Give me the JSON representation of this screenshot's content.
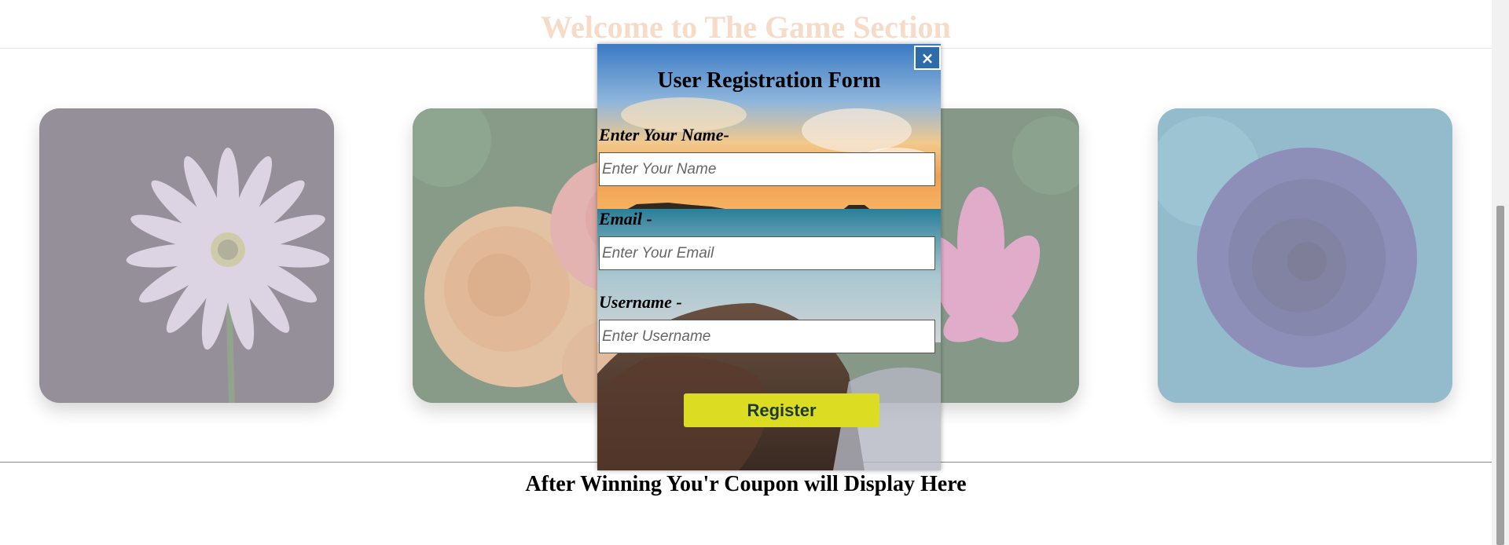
{
  "page": {
    "title": "Welcome to The Game Section",
    "coupon_message": "After Winning You'r Coupon will Display Here"
  },
  "cards": [
    {
      "name": "purple-daisy-card"
    },
    {
      "name": "peach-rose-card"
    },
    {
      "name": "pink-lotus-card"
    },
    {
      "name": "blue-rose-card"
    }
  ],
  "modal": {
    "close_icon": "×",
    "title": "User Registration Form",
    "fields": [
      {
        "label": "Enter Your Name-",
        "placeholder": "Enter Your Name",
        "value": ""
      },
      {
        "label": "Email -",
        "placeholder": "Enter Your Email",
        "value": ""
      },
      {
        "label": "Username -",
        "placeholder": "Enter Username",
        "value": ""
      }
    ],
    "submit_label": "Register"
  },
  "colors": {
    "title": "#f6dcc8",
    "close_button": "#2d6ca9",
    "register_button": "#dcdc23",
    "register_text": "#1e3a34"
  }
}
